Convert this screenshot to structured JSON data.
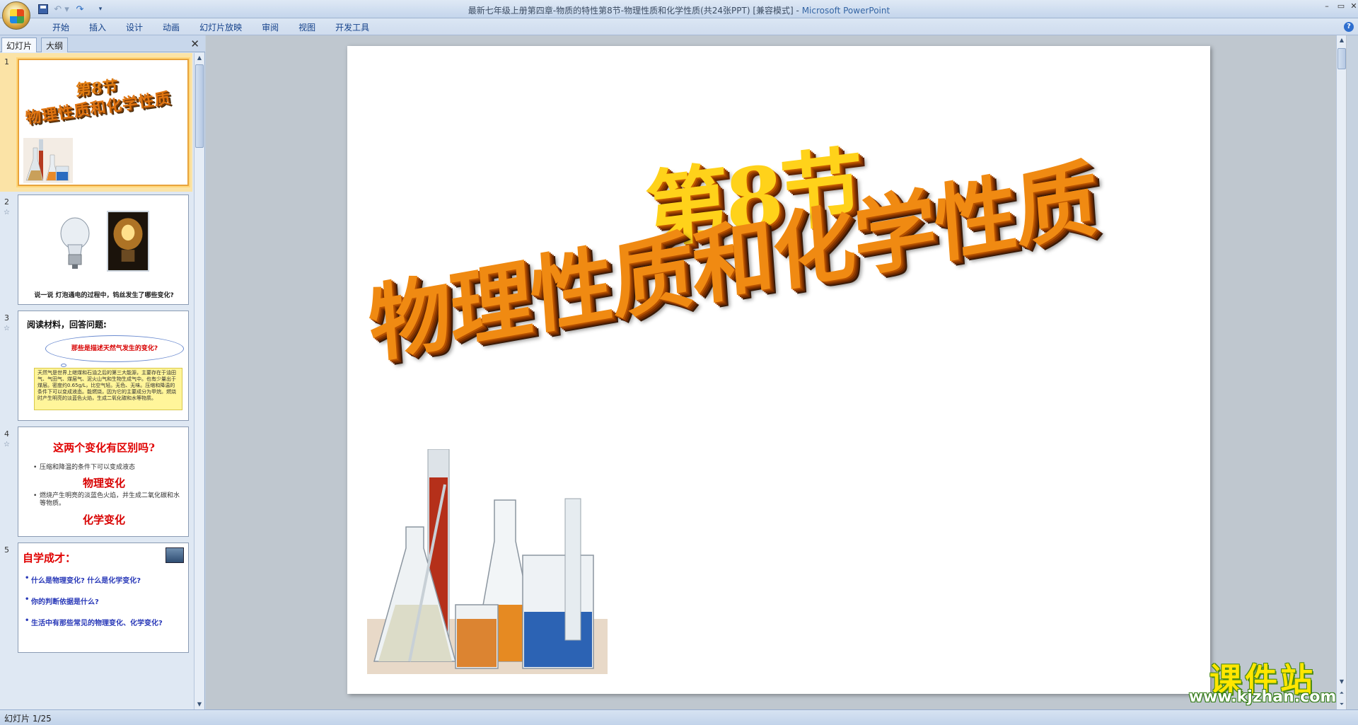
{
  "window": {
    "title": "最新七年级上册第四章-物质的特性第8节-物理性质和化学性质(共24张PPT) [兼容模式]",
    "separator": " - ",
    "app_name": "Microsoft PowerPoint"
  },
  "quick_access": {
    "icons": [
      "save-icon",
      "undo-icon",
      "redo-icon",
      "customize-icon"
    ],
    "undo_glyph": "↶ ▾",
    "redo_glyph": "↷",
    "more_glyph": "▾"
  },
  "window_controls": {
    "minimize": "–",
    "maximize": "▭",
    "close": "✕"
  },
  "ribbon": {
    "tabs": [
      "开始",
      "插入",
      "设计",
      "动画",
      "幻灯片放映",
      "审阅",
      "视图",
      "开发工具"
    ],
    "help": "?"
  },
  "left_pane": {
    "tabs": [
      "幻灯片",
      "大纲"
    ],
    "close": "✕",
    "slides": [
      {
        "number": "1",
        "title_line1": "第8节",
        "title_line2": "物理性质和化学性质"
      },
      {
        "number": "2",
        "star": "☆",
        "caption": "说一说 灯泡通电的过程中，钨丝发生了哪些变化?"
      },
      {
        "number": "3",
        "star": "☆",
        "heading": "阅读材料，回答问题:",
        "cloud": "那些是描述天然气发生的变化?",
        "text": "天然气是世界上继煤和石油之后的第三大能源，主要存在于油田气、气田气、煤层气、泥火山气和生物生成气中。也有少量出于煤层。密度约0.65g/L，比空气轻。无色、无味。压缩和降温的条件下可以变成液态。能燃烧，因为它的主要成分为甲烷。燃烧时产生明亮的淡蓝色火焰，生成二氧化碳和水等物质。"
      },
      {
        "number": "4",
        "star": "☆",
        "title": "这两个变化有区别吗?",
        "bullet1": "压缩和降温的条件下可以变成液态",
        "heading1": "物理变化",
        "bullet2": "燃烧产生明亮的淡蓝色火焰，并生成二氧化碳和水等物质。",
        "heading2": "化学变化"
      },
      {
        "number": "5",
        "title": "自学成才：",
        "q1": "什么是物理变化?      什么是化学变化?",
        "q2": "你的判断依据是什么?",
        "q3": "生活中有那些常见的物理变化、化学变化?"
      }
    ]
  },
  "slide": {
    "title_line1": "第8节",
    "title_line2": "物理性质和化学性质"
  },
  "watermark": {
    "cn": "课件站",
    "url": "www.kjzhan.com"
  },
  "status": {
    "slide_counter": "幻灯片 1/25"
  },
  "colors": {
    "title_yellow": "#ffd21a",
    "title_orange": "#f08a12",
    "thumb_red": "#e00000",
    "selected_border": "#e8a33c"
  }
}
